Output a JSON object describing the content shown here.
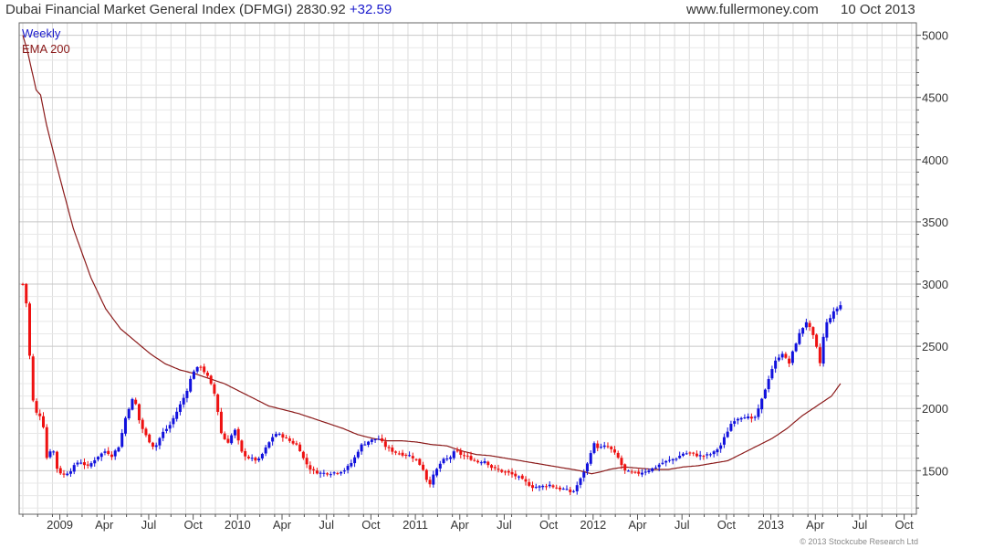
{
  "header": {
    "title": "Dubai Financial Market  General Index (DFMGI)",
    "last": "2830.92",
    "change": "+32.59",
    "source": "www.fullermoney.com",
    "date": "10 Oct 2013"
  },
  "footer": {
    "copyright": "© 2013 Stockcube Research Ltd"
  },
  "chart_data": {
    "type": "candlestick",
    "frequency_label": "Weekly",
    "legend": [
      {
        "name": "Weekly",
        "color": "#1a1acc"
      },
      {
        "name": "EMA 200",
        "color": "#8b1a1a"
      }
    ],
    "colors": {
      "up": "#1111dd",
      "down": "#ee1111",
      "ema": "#8b1a1a",
      "grid": "#dcdcdc"
    },
    "ylim": [
      1150,
      5100
    ],
    "yticks": [
      1500,
      2000,
      2500,
      3000,
      3500,
      4000,
      4500,
      5000
    ],
    "y_axis_side": "right",
    "grid": true,
    "x_ticks": [
      {
        "label": "2009",
        "t": 3.5
      },
      {
        "label": "Apr",
        "t": 6.5
      },
      {
        "label": "Jul",
        "t": 9.5
      },
      {
        "label": "Oct",
        "t": 12.5
      },
      {
        "label": "2010",
        "t": 15.5
      },
      {
        "label": "Apr",
        "t": 18.5
      },
      {
        "label": "Jul",
        "t": 21.5
      },
      {
        "label": "Oct",
        "t": 24.5
      },
      {
        "label": "2011",
        "t": 27.5
      },
      {
        "label": "Apr",
        "t": 30.5
      },
      {
        "label": "Jul",
        "t": 33.5
      },
      {
        "label": "Oct",
        "t": 36.5
      },
      {
        "label": "2012",
        "t": 39.5
      },
      {
        "label": "Apr",
        "t": 42.5
      },
      {
        "label": "Jul",
        "t": 45.5
      },
      {
        "label": "Oct",
        "t": 48.5
      },
      {
        "label": "2013",
        "t": 51.5
      },
      {
        "label": "Apr",
        "t": 54.5
      },
      {
        "label": "Jul",
        "t": 57.5
      },
      {
        "label": "Oct",
        "t": 60.5
      }
    ],
    "t_range": [
      1,
      61.2
    ],
    "close_anchors": [
      [
        1.0,
        3000
      ],
      [
        1.3,
        2800
      ],
      [
        1.6,
        2100
      ],
      [
        2.0,
        1930
      ],
      [
        2.3,
        1960
      ],
      [
        2.6,
        1600
      ],
      [
        3.0,
        1700
      ],
      [
        3.3,
        1520
      ],
      [
        3.7,
        1460
      ],
      [
        4.2,
        1500
      ],
      [
        4.8,
        1580
      ],
      [
        5.4,
        1530
      ],
      [
        6.0,
        1610
      ],
      [
        6.6,
        1660
      ],
      [
        7.0,
        1620
      ],
      [
        7.5,
        1700
      ],
      [
        8.0,
        1960
      ],
      [
        8.5,
        2100
      ],
      [
        8.9,
        1880
      ],
      [
        9.4,
        1760
      ],
      [
        9.9,
        1680
      ],
      [
        10.4,
        1800
      ],
      [
        10.9,
        1860
      ],
      [
        11.5,
        2000
      ],
      [
        12.0,
        2120
      ],
      [
        12.5,
        2300
      ],
      [
        13.0,
        2340
      ],
      [
        13.5,
        2250
      ],
      [
        14.0,
        2100
      ],
      [
        14.4,
        1800
      ],
      [
        14.8,
        1720
      ],
      [
        15.3,
        1830
      ],
      [
        15.8,
        1640
      ],
      [
        16.3,
        1600
      ],
      [
        16.9,
        1580
      ],
      [
        17.5,
        1700
      ],
      [
        18.0,
        1800
      ],
      [
        18.5,
        1780
      ],
      [
        19.0,
        1740
      ],
      [
        19.6,
        1700
      ],
      [
        20.0,
        1580
      ],
      [
        20.5,
        1500
      ],
      [
        21.1,
        1480
      ],
      [
        21.7,
        1480
      ],
      [
        22.3,
        1490
      ],
      [
        22.8,
        1510
      ],
      [
        23.3,
        1580
      ],
      [
        23.8,
        1700
      ],
      [
        24.4,
        1740
      ],
      [
        25.0,
        1760
      ],
      [
        25.6,
        1680
      ],
      [
        26.1,
        1650
      ],
      [
        26.7,
        1630
      ],
      [
        27.2,
        1620
      ],
      [
        27.6,
        1580
      ],
      [
        28.0,
        1520
      ],
      [
        28.4,
        1380
      ],
      [
        28.8,
        1480
      ],
      [
        29.3,
        1580
      ],
      [
        29.8,
        1600
      ],
      [
        30.2,
        1660
      ],
      [
        30.7,
        1620
      ],
      [
        31.2,
        1600
      ],
      [
        31.7,
        1570
      ],
      [
        32.2,
        1580
      ],
      [
        32.7,
        1520
      ],
      [
        33.2,
        1500
      ],
      [
        33.8,
        1480
      ],
      [
        34.4,
        1450
      ],
      [
        34.9,
        1410
      ],
      [
        35.4,
        1370
      ],
      [
        36.0,
        1370
      ],
      [
        36.5,
        1390
      ],
      [
        37.0,
        1360
      ],
      [
        37.6,
        1350
      ],
      [
        38.1,
        1320
      ],
      [
        38.6,
        1420
      ],
      [
        39.1,
        1550
      ],
      [
        39.5,
        1720
      ],
      [
        39.9,
        1680
      ],
      [
        40.4,
        1700
      ],
      [
        40.8,
        1660
      ],
      [
        41.2,
        1600
      ],
      [
        41.6,
        1500
      ],
      [
        42.1,
        1480
      ],
      [
        42.6,
        1480
      ],
      [
        43.1,
        1500
      ],
      [
        43.6,
        1520
      ],
      [
        44.1,
        1560
      ],
      [
        44.6,
        1580
      ],
      [
        45.1,
        1600
      ],
      [
        45.6,
        1640
      ],
      [
        46.1,
        1640
      ],
      [
        46.6,
        1620
      ],
      [
        47.1,
        1620
      ],
      [
        47.6,
        1640
      ],
      [
        48.1,
        1700
      ],
      [
        48.5,
        1800
      ],
      [
        48.9,
        1900
      ],
      [
        49.4,
        1930
      ],
      [
        49.8,
        1940
      ],
      [
        50.3,
        1900
      ],
      [
        50.7,
        2000
      ],
      [
        51.1,
        2150
      ],
      [
        51.5,
        2300
      ],
      [
        51.9,
        2400
      ],
      [
        52.3,
        2450
      ],
      [
        52.7,
        2350
      ],
      [
        53.1,
        2500
      ],
      [
        53.5,
        2620
      ],
      [
        53.9,
        2700
      ],
      [
        54.3,
        2600
      ],
      [
        54.6,
        2480
      ],
      [
        54.8,
        2350
      ],
      [
        55.0,
        2550
      ],
      [
        55.3,
        2700
      ],
      [
        55.6,
        2750
      ],
      [
        55.9,
        2798
      ],
      [
        56.2,
        2830
      ]
    ],
    "ema200_anchors": [
      [
        1.0,
        5000
      ],
      [
        1.3,
        4880
      ],
      [
        1.9,
        4560
      ],
      [
        2.2,
        4520
      ],
      [
        2.6,
        4280
      ],
      [
        3.4,
        3900
      ],
      [
        4.4,
        3450
      ],
      [
        5.6,
        3050
      ],
      [
        6.6,
        2800
      ],
      [
        7.6,
        2640
      ],
      [
        8.6,
        2540
      ],
      [
        9.6,
        2440
      ],
      [
        10.6,
        2360
      ],
      [
        11.6,
        2310
      ],
      [
        12.6,
        2280
      ],
      [
        13.6,
        2240
      ],
      [
        14.6,
        2200
      ],
      [
        15.6,
        2140
      ],
      [
        16.6,
        2080
      ],
      [
        17.6,
        2020
      ],
      [
        18.6,
        1990
      ],
      [
        19.6,
        1960
      ],
      [
        20.6,
        1920
      ],
      [
        21.6,
        1880
      ],
      [
        22.6,
        1840
      ],
      [
        23.6,
        1790
      ],
      [
        24.6,
        1760
      ],
      [
        25.6,
        1740
      ],
      [
        26.6,
        1740
      ],
      [
        27.6,
        1730
      ],
      [
        28.6,
        1710
      ],
      [
        29.6,
        1700
      ],
      [
        30.6,
        1660
      ],
      [
        31.6,
        1630
      ],
      [
        32.6,
        1620
      ],
      [
        33.6,
        1600
      ],
      [
        34.6,
        1580
      ],
      [
        35.6,
        1560
      ],
      [
        36.6,
        1540
      ],
      [
        37.6,
        1520
      ],
      [
        38.6,
        1500
      ],
      [
        39.4,
        1475
      ],
      [
        40.0,
        1490
      ],
      [
        40.6,
        1510
      ],
      [
        41.6,
        1530
      ],
      [
        42.6,
        1520
      ],
      [
        43.6,
        1510
      ],
      [
        44.6,
        1510
      ],
      [
        45.6,
        1530
      ],
      [
        46.6,
        1540
      ],
      [
        47.6,
        1560
      ],
      [
        48.6,
        1580
      ],
      [
        49.6,
        1640
      ],
      [
        50.6,
        1700
      ],
      [
        51.6,
        1760
      ],
      [
        52.6,
        1840
      ],
      [
        53.6,
        1940
      ],
      [
        54.6,
        2020
      ],
      [
        55.6,
        2100
      ],
      [
        56.2,
        2200
      ]
    ]
  }
}
